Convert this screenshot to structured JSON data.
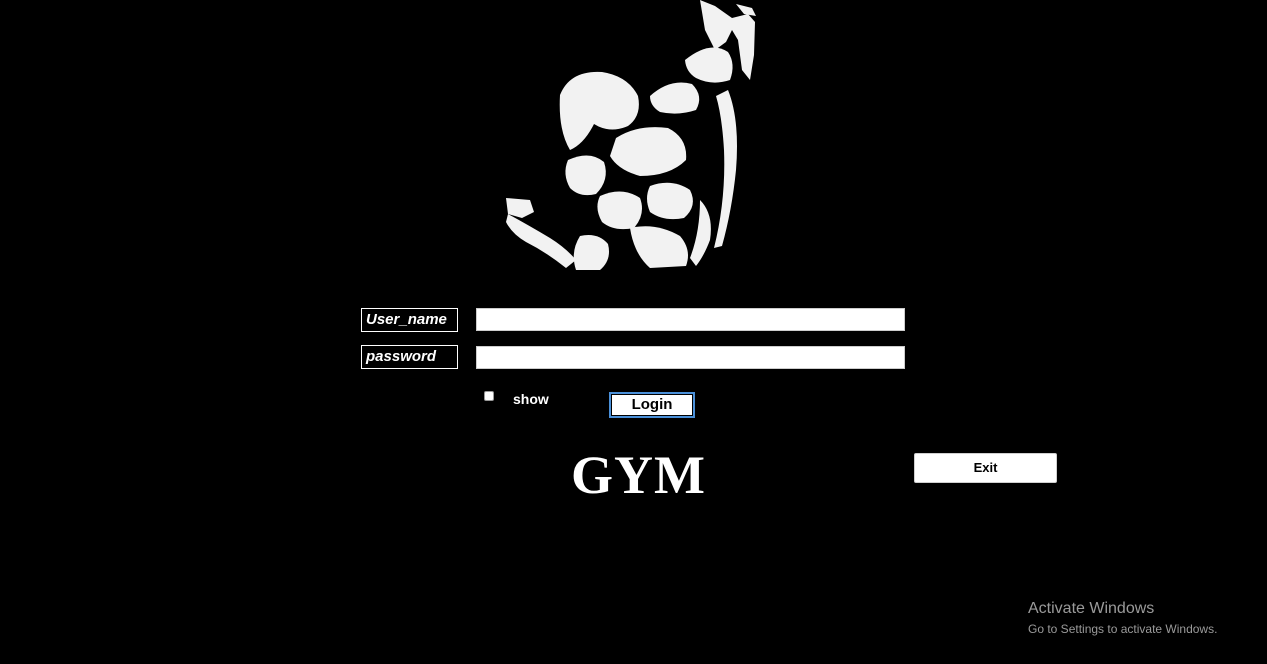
{
  "login_form": {
    "username_label": "User_name",
    "password_label": "password",
    "username_value": "",
    "password_value": "",
    "show_label": "show",
    "show_checked": false,
    "login_label": "Login"
  },
  "brand": {
    "logo_icon": "bodybuilder-flexing-icon",
    "title": "GYM"
  },
  "exit_label": "Exit",
  "watermark": {
    "title": "Activate Windows",
    "subtitle": "Go to Settings to activate Windows."
  },
  "colors": {
    "background": "#000000",
    "foreground": "#ffffff",
    "login_focus_border": "#4a90d9"
  }
}
